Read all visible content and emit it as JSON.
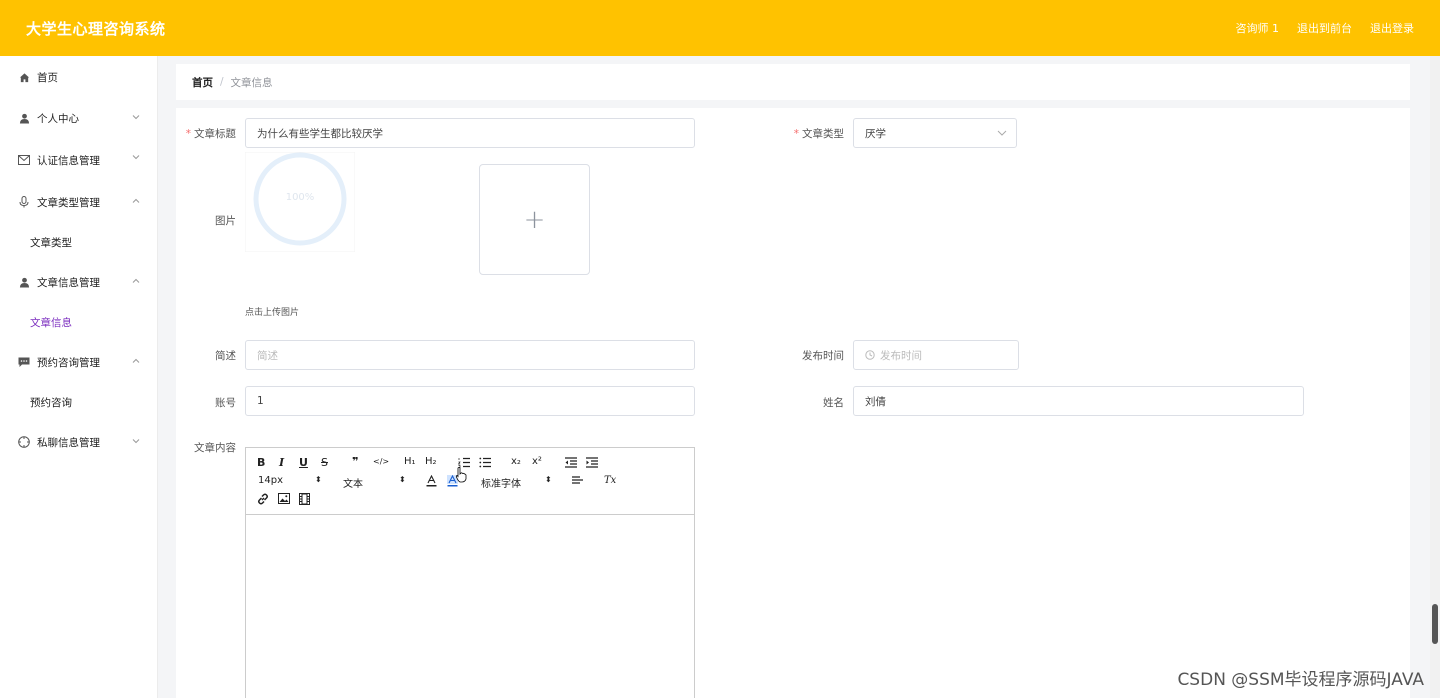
{
  "app": {
    "title": "大学生心理咨询系统"
  },
  "topnav": {
    "user": "咨询师 1",
    "front": "退出到前台",
    "logout": "退出登录"
  },
  "sidebar": {
    "items": [
      {
        "label": "首页"
      },
      {
        "label": "个人中心"
      },
      {
        "label": "认证信息管理"
      },
      {
        "label": "文章类型管理"
      },
      {
        "label": "文章类型"
      },
      {
        "label": "文章信息管理"
      },
      {
        "label": "文章信息"
      },
      {
        "label": "预约咨询管理"
      },
      {
        "label": "预约咨询"
      },
      {
        "label": "私聊信息管理"
      }
    ]
  },
  "breadcrumb": {
    "home": "首页",
    "sep": "/",
    "current": "文章信息"
  },
  "form": {
    "title_label": "文章标题",
    "title_value": "为什么有些学生都比较厌学",
    "type_label": "文章类型",
    "type_value": "厌学",
    "image_label": "图片",
    "progress_text": "100%",
    "upload_plus": "+",
    "upload_hint": "点击上传图片",
    "desc_label": "简述",
    "desc_placeholder": "简述",
    "time_label": "发布时间",
    "time_placeholder": "发布时间",
    "account_label": "账号",
    "account_value": "1",
    "name_label": "姓名",
    "name_value": "刘倩",
    "content_label": "文章内容"
  },
  "editor": {
    "bold": "B",
    "italic": "I",
    "underline": "U",
    "strike": "S",
    "quote": "❞",
    "code": "</>",
    "h1": "H₁",
    "h2": "H₂",
    "sub": "x₂",
    "sup": "x²",
    "size": "14px",
    "header": "文本",
    "font": "标准字体",
    "clean": "Tx"
  },
  "watermark": "CSDN @SSM毕设程序源码JAVA"
}
